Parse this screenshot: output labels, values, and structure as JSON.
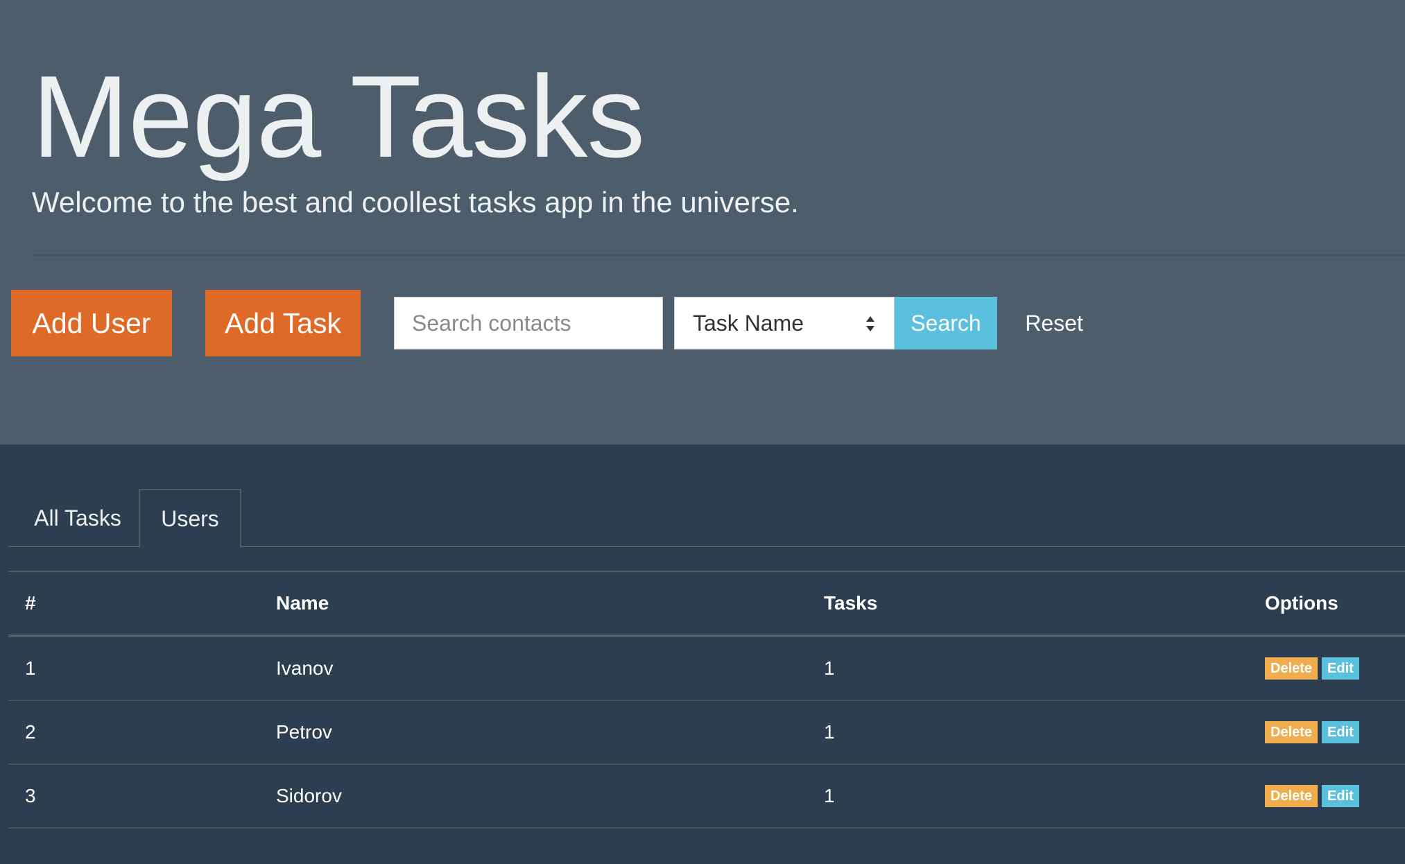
{
  "hero": {
    "title": "Mega Tasks",
    "subtitle": "Welcome to the best and coollest tasks app in the universe."
  },
  "toolbar": {
    "add_user": "Add User",
    "add_task": "Add Task",
    "search_placeholder": "Search contacts",
    "search_field_value": "Task Name",
    "search_button": "Search",
    "reset": "Reset"
  },
  "tabs": [
    {
      "label": "All Tasks",
      "active": false
    },
    {
      "label": "Users",
      "active": true
    }
  ],
  "table": {
    "headers": [
      "#",
      "Name",
      "Tasks",
      "Options"
    ],
    "rows": [
      {
        "num": "1",
        "name": "Ivanov",
        "tasks": "1"
      },
      {
        "num": "2",
        "name": "Petrov",
        "tasks": "1"
      },
      {
        "num": "3",
        "name": "Sidorov",
        "tasks": "1"
      }
    ],
    "delete_label": "Delete",
    "edit_label": "Edit"
  },
  "colors": {
    "hero_bg": "#4e5d6c",
    "page_bg": "#2c3e50",
    "accent_orange": "#df6a28",
    "info_blue": "#5bc0de",
    "warning": "#f0ad4e"
  }
}
